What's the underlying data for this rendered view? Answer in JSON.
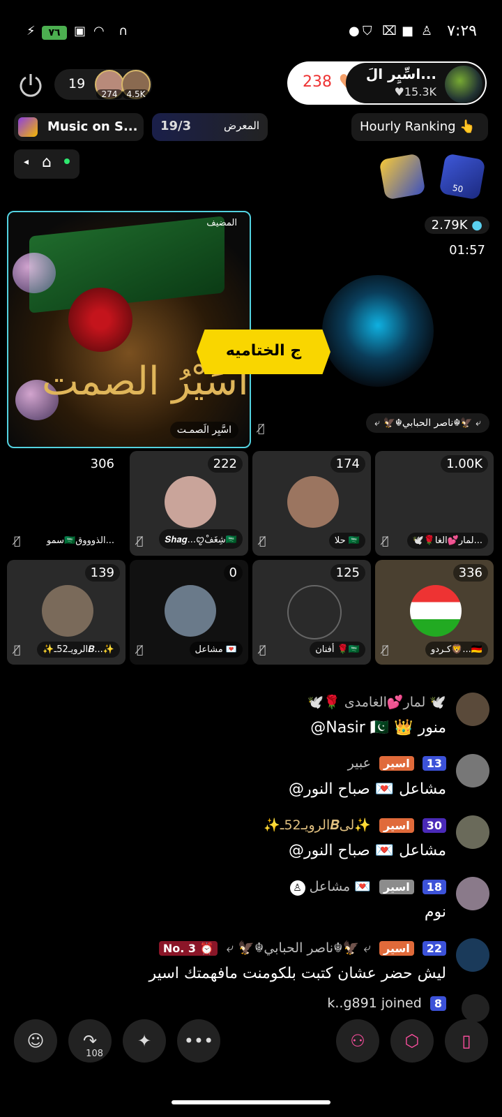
{
  "status_bar": {
    "time": "٧:٢٩",
    "battery": "٧٦"
  },
  "header": {
    "viewer_count": "19",
    "avatar1_count": "274",
    "avatar2_count": "4.5K",
    "host_name": "اسِّيِر الَ...",
    "host_fans": "15.3K",
    "likes": "238"
  },
  "bar": {
    "music": "Music on S...",
    "gallery_label": "المعرض",
    "gallery_progress": "19/3",
    "ranking": "Hourly Ranking 👆"
  },
  "badges": {
    "fan_level": "50"
  },
  "host_box": {
    "role": "المضيف",
    "art_text": "اسَيْرُ الصمت",
    "name": "اسَّيِر الَصمـت"
  },
  "guest_top": {
    "count": "2.79K",
    "timer": "01:57",
    "name": "⤶ 🦅☬ناصر الحبابي☬🦅 ⤶"
  },
  "banner": {
    "text": "ج الختاميه"
  },
  "tiles": [
    {
      "count": "306",
      "name": "سمو🇸🇦الذوووق..."
    },
    {
      "count": "222",
      "name": "𝑺𝒉𝒂𝒈...ꨄشِغَفْ🇸🇦"
    },
    {
      "count": "174",
      "name": "حلا 🇸🇦"
    },
    {
      "count": "1.00K",
      "name": "🕊️🌹لمار💕الغا..."
    },
    {
      "count": "139",
      "name": "✨الرويـ52ـ𝑩...✨"
    },
    {
      "count": "0",
      "name": "مشاعل 💌"
    },
    {
      "count": "125",
      "name": "أفنان 🌹🇸🇦"
    },
    {
      "count": "336",
      "name": "كـردو🦁...🇩🇪"
    }
  ],
  "chat": [
    {
      "meta": "🕊️🌹 لمار💕الغامدى 🕊️",
      "message": "@Nasir 🇵🇰 👑 منور",
      "level": "",
      "tag": ""
    },
    {
      "meta": "عبير",
      "message": "@مشاعل 💌 صباح النور",
      "level": "13",
      "tag": "اسير"
    },
    {
      "meta": "✨الرويـ52ـ𝑩لى✨",
      "message": "@مشاعل 💌 صباح النور",
      "level": "30",
      "tag": "اسير"
    },
    {
      "meta": "مشاعل 💌",
      "message": "نوم",
      "level": "18",
      "tag": "اسير"
    },
    {
      "meta": "⤶ 🦅☬ناصر الحبابي☬🦅 ⤶",
      "message": "ليش حضر عشان كتبت بلكومنت مافهمتك اسير",
      "level": "22",
      "tag": "اسير",
      "rank": "No. 3 ⏰"
    },
    {
      "meta": "k..g891 joined",
      "message": "",
      "level": "8",
      "tag": ""
    }
  ],
  "toolbar": {
    "share_count": "108"
  }
}
